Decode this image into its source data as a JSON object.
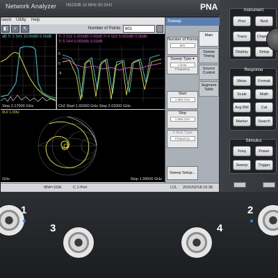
{
  "header": {
    "title": "Network Analyzer",
    "model": "N5230B  10 MHz-50 GHz",
    "brand": "PNA"
  },
  "menu": [
    "twork",
    "Utility",
    "Help"
  ],
  "toolbar": {
    "points_label": "Number of Points",
    "points_value": "801"
  },
  "win1": {
    "header": "dB  Tr 2  S41 10.00dB/  0.00dB",
    "footer": "Stop  2.17000 GHz"
  },
  "win2": {
    "header1": "Tr 3  S11 5.000dB/  0.00dB    Tr 4  S22 5.000dB/  0.00dB",
    "header2": "Tr 5  S44 5.000dB/  0.00dB",
    "footer": "Ch2  Start  1.92000 GHz               Stop  2.02000 GHz"
  },
  "win3": {
    "header": "0U/  1.00U",
    "footer_left": "GHz",
    "footer_right": "Stop  1.99500 GHz"
  },
  "status": {
    "bw": "IBW=100k",
    "cal": "C  1-Port",
    "lcl": "LCL",
    "timestamp": "2016/02/18 16:38"
  },
  "softkeys": {
    "header": "Sweep",
    "number_of_points": "Number of Points",
    "number_of_points_value": "801",
    "sweep_type": "Sweep Type",
    "sweep_type_value": "Linear Frequency",
    "start": "Start",
    "start_value": "1.900 GHz",
    "stop": "Stop",
    "stop_value": "1.995 GHz",
    "x_axis_type": "X Axis Type",
    "x_axis_value": "Frequency",
    "sweep_setup": "Sweep Setup...",
    "tabs": [
      "Main",
      "Sweep Timing",
      "Source Control",
      "Segment Table"
    ]
  },
  "panel": {
    "instrument_title": "Instrument",
    "instrument_keys": [
      "Prev",
      "Next",
      "Trace",
      "Channel",
      "Display",
      "Setup"
    ],
    "response_title": "Response",
    "response_keys": [
      "Meas",
      "Format",
      "Scale",
      "Math",
      "Avg BW",
      "Cal",
      "Marker",
      "Search"
    ],
    "stimulus_title": "Stimulus",
    "stimulus_keys": [
      "Freq",
      "Power",
      "Sweep",
      "Trigger"
    ]
  },
  "ports": {
    "p1": "1",
    "p2": "2",
    "p3": "3",
    "p4": "4"
  },
  "colors": {
    "trace_yellow": "#e8e010",
    "trace_cyan": "#37d6e6",
    "trace_magenta": "#e04fd8",
    "trace_white": "#f0f0f0",
    "softkey_header": "#5c7fb1",
    "led_blue": "#3d7bd6"
  }
}
